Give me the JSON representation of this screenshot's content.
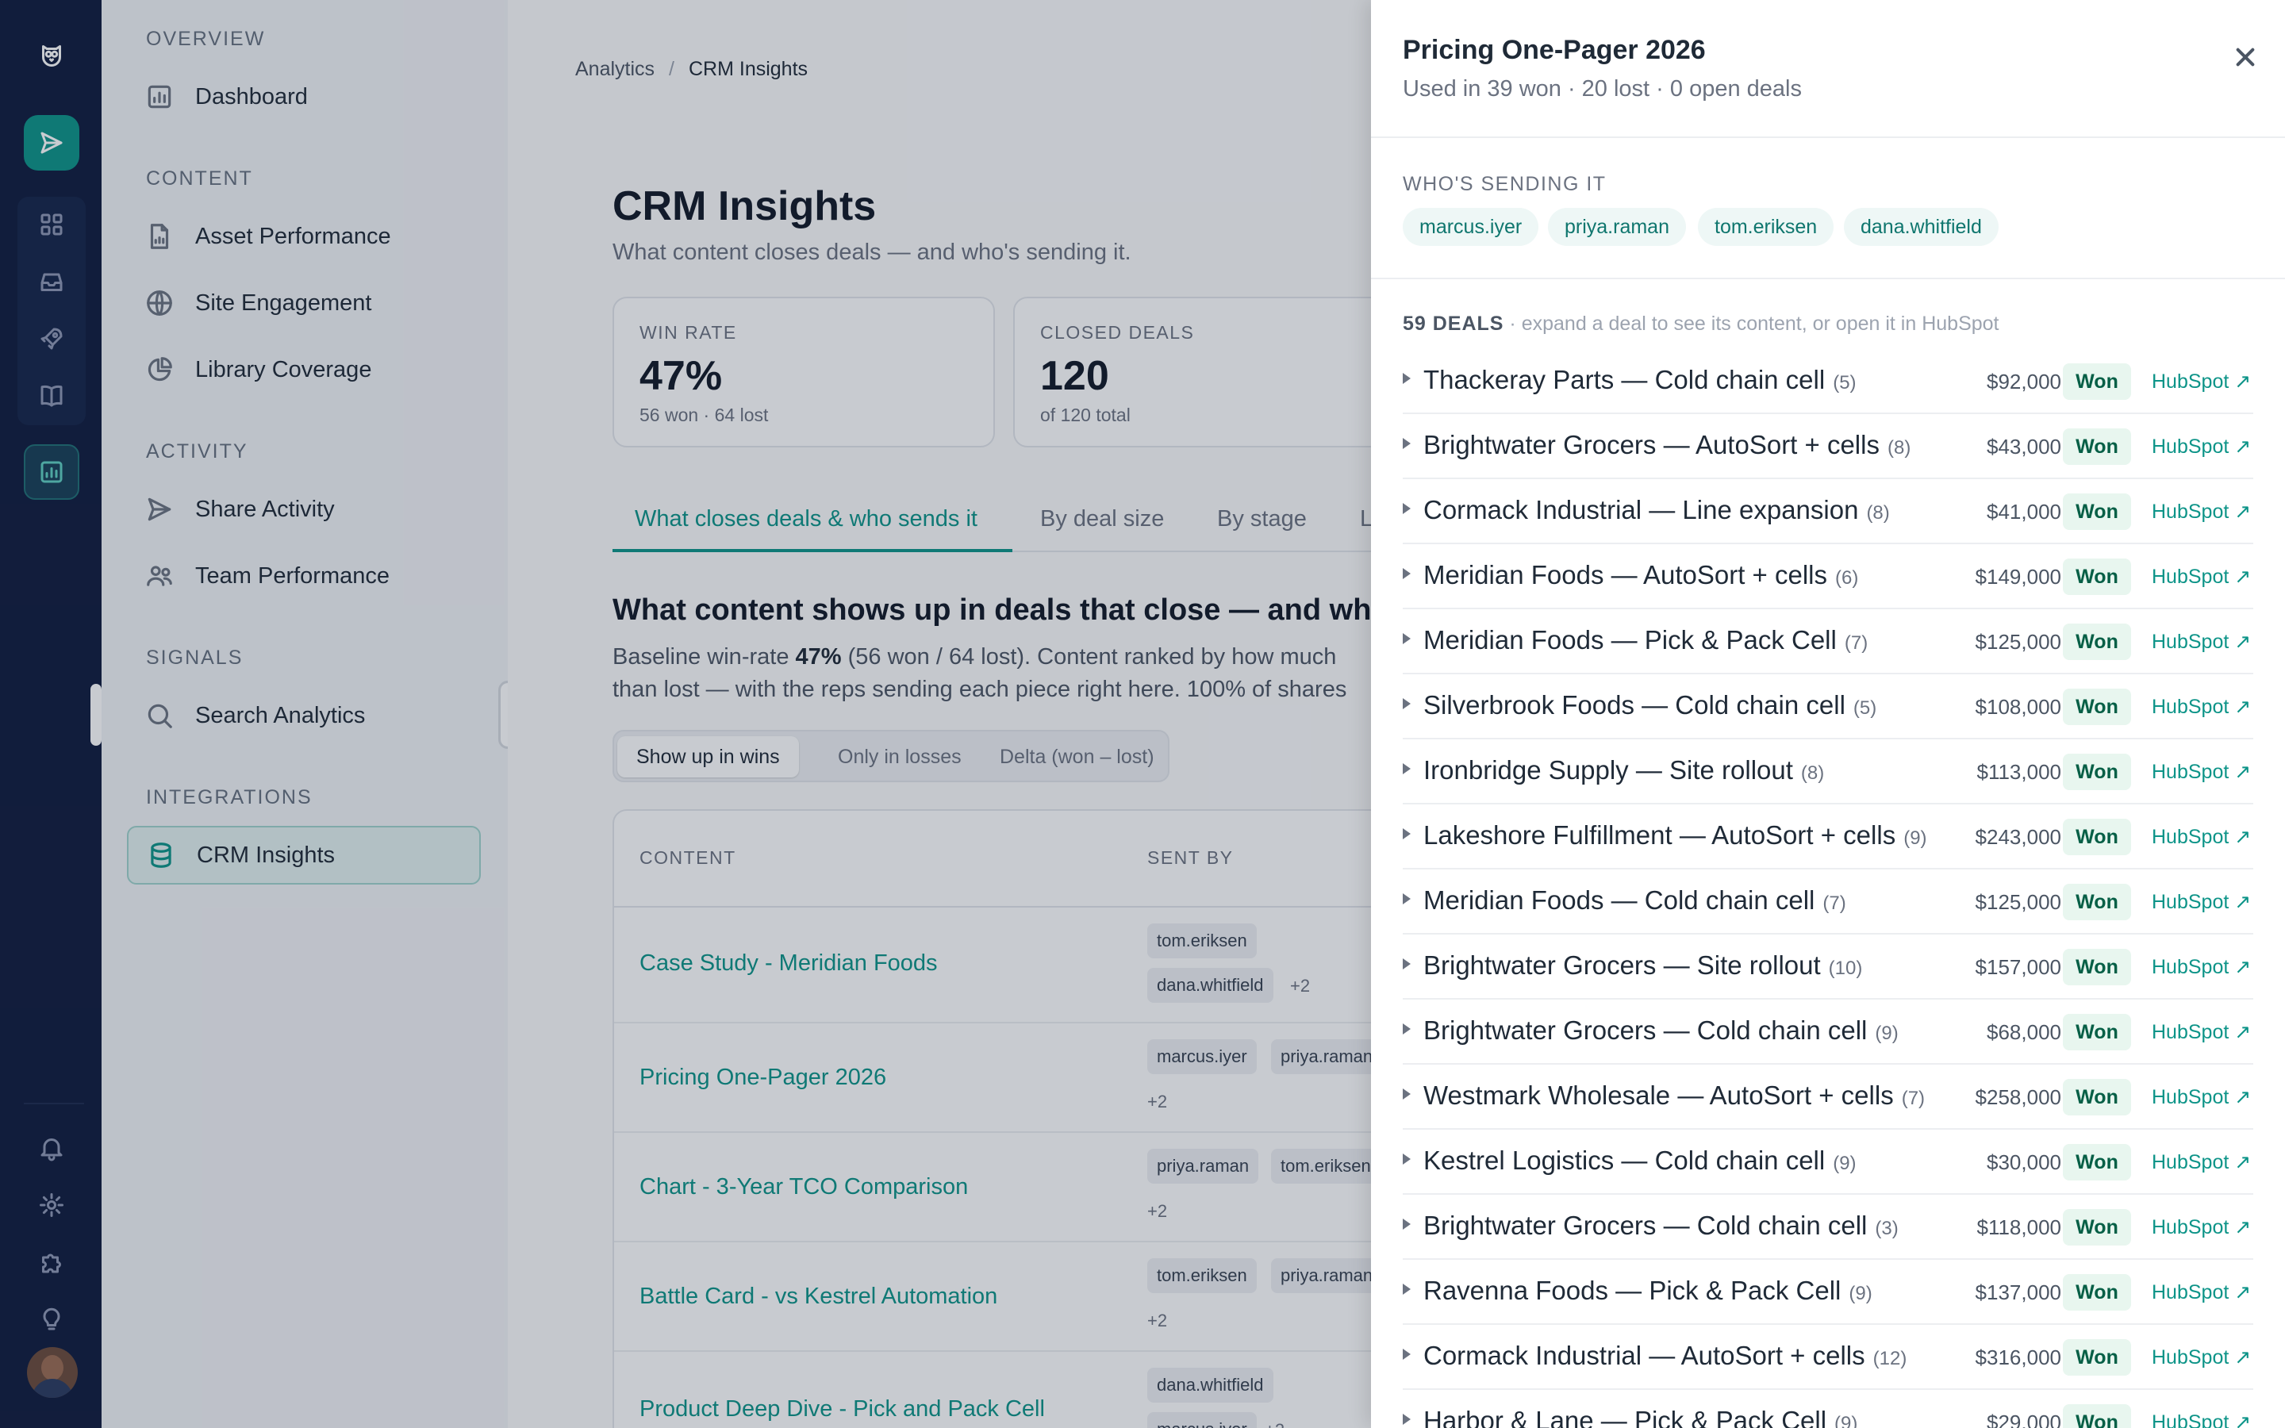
{
  "sidebar": {
    "sections": [
      {
        "title": "OVERVIEW",
        "items": [
          {
            "label": "Dashboard",
            "icon": "dashboard-chart-icon"
          }
        ]
      },
      {
        "title": "CONTENT",
        "items": [
          {
            "label": "Asset Performance",
            "icon": "document-chart-icon"
          },
          {
            "label": "Site Engagement",
            "icon": "globe-icon"
          },
          {
            "label": "Library Coverage",
            "icon": "pie-chart-icon"
          }
        ]
      },
      {
        "title": "ACTIVITY",
        "items": [
          {
            "label": "Share Activity",
            "icon": "send-icon"
          },
          {
            "label": "Team Performance",
            "icon": "team-icon"
          }
        ]
      },
      {
        "title": "SIGNALS",
        "items": [
          {
            "label": "Search Analytics",
            "icon": "search-icon"
          }
        ]
      },
      {
        "title": "INTEGRATIONS",
        "items": [
          {
            "label": "CRM Insights",
            "icon": "database-icon",
            "active": true
          }
        ]
      }
    ]
  },
  "breadcrumb": {
    "parent": "Analytics",
    "separator": "/",
    "current": "CRM Insights"
  },
  "page": {
    "title": "CRM Insights",
    "subtitle": "What content closes deals — and who's sending it."
  },
  "stats": [
    {
      "label": "WIN RATE",
      "value": "47%",
      "sub": "56 won · 64 lost"
    },
    {
      "label": "CLOSED DEALS",
      "value": "120",
      "sub": "of 120 total"
    }
  ],
  "tabs": [
    {
      "label": "What closes deals & who sends it",
      "active": true
    },
    {
      "label": "By deal size"
    },
    {
      "label": "By stage"
    },
    {
      "label": "L"
    }
  ],
  "section": {
    "title": "What content shows up in deals that close — and who's",
    "para_line1_a": "Baseline win-rate ",
    "para_line1_b": "47%",
    "para_line1_c": " (56 won / 64 lost). Content ranked by how much",
    "para_line2": "than lost — with the reps sending each piece right here. 100% of shares"
  },
  "segments": [
    {
      "label": "Show up in wins",
      "active": true
    },
    {
      "label": "Only in losses"
    },
    {
      "label": "Delta (won – lost)"
    }
  ],
  "table": {
    "headers": {
      "content": "CONTENT",
      "sent_by": "SENT BY"
    },
    "rows": [
      {
        "name": "Case Study - Meridian Foods",
        "chips": [
          "tom.eriksen",
          "dana.whitfield"
        ],
        "more": "+2"
      },
      {
        "name": "Pricing One-Pager 2026",
        "chips": [
          "marcus.iyer",
          "priya.raman"
        ],
        "more": "+2"
      },
      {
        "name": "Chart - 3-Year TCO Comparison",
        "chips": [
          "priya.raman",
          "tom.eriksen"
        ],
        "more": "+2"
      },
      {
        "name": "Battle Card - vs Kestrel Automation",
        "chips": [
          "tom.eriksen",
          "priya.raman"
        ],
        "more": "+2"
      },
      {
        "name": "Product Deep Dive - Pick and Pack Cell",
        "chips": [
          "dana.whitfield",
          "marcus.iyer"
        ],
        "more": "+2"
      }
    ]
  },
  "drawer": {
    "title": "Pricing One-Pager 2026",
    "subtitle": "Used in 39 won · 20 lost · 0 open deals",
    "who_title": "WHO'S SENDING IT",
    "reps": [
      "marcus.iyer",
      "priya.raman",
      "tom.eriksen",
      "dana.whitfield"
    ],
    "deal_count": "59 DEALS",
    "deal_hint": " · expand a deal to see its content, or open it in HubSpot",
    "deals": [
      {
        "name": "Thackeray Parts — Cold chain cell",
        "count": "(5)",
        "amount": "$92,000",
        "status": "Won",
        "link": "HubSpot ↗"
      },
      {
        "name": "Brightwater Grocers — AutoSort + cells",
        "count": "(8)",
        "amount": "$43,000",
        "status": "Won",
        "link": "HubSpot ↗"
      },
      {
        "name": "Cormack Industrial — Line expansion",
        "count": "(8)",
        "amount": "$41,000",
        "status": "Won",
        "link": "HubSpot ↗"
      },
      {
        "name": "Meridian Foods — AutoSort + cells",
        "count": "(6)",
        "amount": "$149,000",
        "status": "Won",
        "link": "HubSpot ↗"
      },
      {
        "name": "Meridian Foods — Pick & Pack Cell",
        "count": "(7)",
        "amount": "$125,000",
        "status": "Won",
        "link": "HubSpot ↗"
      },
      {
        "name": "Silverbrook Foods — Cold chain cell",
        "count": "(5)",
        "amount": "$108,000",
        "status": "Won",
        "link": "HubSpot ↗"
      },
      {
        "name": "Ironbridge Supply — Site rollout",
        "count": "(8)",
        "amount": "$113,000",
        "status": "Won",
        "link": "HubSpot ↗"
      },
      {
        "name": "Lakeshore Fulfillment — AutoSort + cells",
        "count": "(9)",
        "amount": "$243,000",
        "status": "Won",
        "link": "HubSpot ↗"
      },
      {
        "name": "Meridian Foods — Cold chain cell",
        "count": "(7)",
        "amount": "$125,000",
        "status": "Won",
        "link": "HubSpot ↗"
      },
      {
        "name": "Brightwater Grocers — Site rollout",
        "count": "(10)",
        "amount": "$157,000",
        "status": "Won",
        "link": "HubSpot ↗"
      },
      {
        "name": "Brightwater Grocers — Cold chain cell",
        "count": "(9)",
        "amount": "$68,000",
        "status": "Won",
        "link": "HubSpot ↗"
      },
      {
        "name": "Westmark Wholesale — AutoSort + cells",
        "count": "(7)",
        "amount": "$258,000",
        "status": "Won",
        "link": "HubSpot ↗"
      },
      {
        "name": "Kestrel Logistics — Cold chain cell",
        "count": "(9)",
        "amount": "$30,000",
        "status": "Won",
        "link": "HubSpot ↗"
      },
      {
        "name": "Brightwater Grocers — Cold chain cell",
        "count": "(3)",
        "amount": "$118,000",
        "status": "Won",
        "link": "HubSpot ↗"
      },
      {
        "name": "Ravenna Foods — Pick & Pack Cell",
        "count": "(9)",
        "amount": "$137,000",
        "status": "Won",
        "link": "HubSpot ↗"
      },
      {
        "name": "Cormack Industrial — AutoSort + cells",
        "count": "(12)",
        "amount": "$316,000",
        "status": "Won",
        "link": "HubSpot ↗"
      },
      {
        "name": "Harbor & Lane — Pick & Pack Cell",
        "count": "(9)",
        "amount": "$29,000",
        "status": "Won",
        "link": "HubSpot ↗"
      }
    ]
  }
}
